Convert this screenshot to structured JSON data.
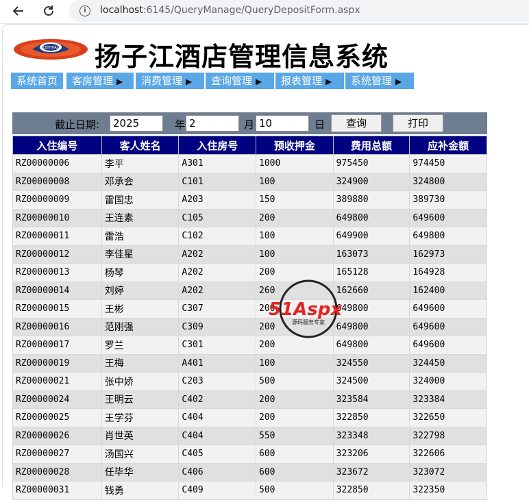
{
  "browser": {
    "url_host": "localhost",
    "url_rest": ":6145/QueryManage/QueryDepositForm.aspx"
  },
  "header": {
    "title": "扬子江酒店管理信息系统",
    "logo_text": "CENTRAL"
  },
  "menu": {
    "items": [
      {
        "label": "系统首页",
        "arrow": ""
      },
      {
        "label": "客房管理",
        "arrow": "▶"
      },
      {
        "label": "消费管理",
        "arrow": "▶"
      },
      {
        "label": "查询管理",
        "arrow": "▶"
      },
      {
        "label": "报表管理",
        "arrow": "▶"
      },
      {
        "label": "系统管理",
        "arrow": "▶"
      }
    ]
  },
  "form": {
    "date_label": "截止日期:",
    "year_value": "2025",
    "year_label": "年",
    "month_value": "2",
    "month_label": "月",
    "day_value": "10",
    "day_label": "日",
    "query_button": "查询",
    "print_button": "打印"
  },
  "table": {
    "columns": [
      "入住编号",
      "客人姓名",
      "入住房号",
      "预收押金",
      "费用总额",
      "应补金额"
    ],
    "rows": [
      [
        "RZ00000006",
        "李平",
        "A301",
        "1000",
        "975450",
        "974450"
      ],
      [
        "RZ00000008",
        "邓承会",
        "C101",
        "100",
        "324900",
        "324800"
      ],
      [
        "RZ00000009",
        "雷国忠",
        "A203",
        "150",
        "389880",
        "389730"
      ],
      [
        "RZ00000010",
        "王连素",
        "C105",
        "200",
        "649800",
        "649600"
      ],
      [
        "RZ00000011",
        "雷浩",
        "C102",
        "100",
        "649900",
        "649800"
      ],
      [
        "RZ00000012",
        "李佳星",
        "A202",
        "100",
        "163073",
        "162973"
      ],
      [
        "RZ00000013",
        "杨琴",
        "A202",
        "200",
        "165128",
        "164928"
      ],
      [
        "RZ00000014",
        "刘婷",
        "A202",
        "260",
        "162660",
        "162400"
      ],
      [
        "RZ00000015",
        "王彬",
        "C307",
        "200",
        "649800",
        "649600"
      ],
      [
        "RZ00000016",
        "范刚强",
        "C309",
        "200",
        "649800",
        "649600"
      ],
      [
        "RZ00000017",
        "罗兰",
        "C301",
        "200",
        "649800",
        "649600"
      ],
      [
        "RZ00000019",
        "王梅",
        "A401",
        "100",
        "324550",
        "324450"
      ],
      [
        "RZ00000021",
        "张中娇",
        "C203",
        "500",
        "324500",
        "324000"
      ],
      [
        "RZ00000024",
        "王明云",
        "C402",
        "200",
        "323584",
        "323384"
      ],
      [
        "RZ00000025",
        "王学芬",
        "C404",
        "200",
        "322850",
        "322650"
      ],
      [
        "RZ00000026",
        "肖世英",
        "C404",
        "550",
        "323348",
        "322798"
      ],
      [
        "RZ00000027",
        "汤国兴",
        "C405",
        "600",
        "323206",
        "322606"
      ],
      [
        "RZ00000028",
        "任毕华",
        "C406",
        "600",
        "323672",
        "323072"
      ],
      [
        "RZ00000031",
        "钱勇",
        "C409",
        "500",
        "322850",
        "322350"
      ]
    ]
  },
  "watermark": {
    "brand": "51Aspx",
    "tagline": "源码服务专家"
  },
  "colors": {
    "menu_bg": "#5aa7e8",
    "table_header_bg": "#000080",
    "form_bar_bg": "#6e7d8f"
  }
}
